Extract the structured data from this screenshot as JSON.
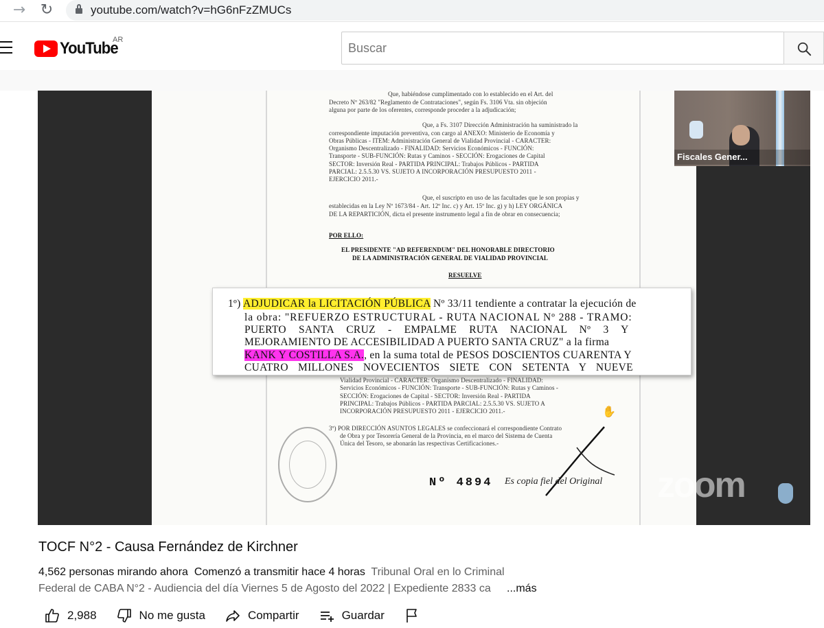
{
  "browser": {
    "url": "youtube.com/watch?v=hG6nFzZMUCs",
    "forward_icon": "arrow-forward-icon",
    "reload_icon": "reload-icon"
  },
  "header": {
    "logo_text": "YouTube",
    "region": "AR",
    "search_placeholder": "Buscar"
  },
  "video": {
    "camera_label": "Fiscales Gener...",
    "watermark": "zoom",
    "doc_top_lines": [
      "Que, habiéndose cumplimentado con lo establecido en el Art. del",
      "Decreto Nº 263/82 \"Reglamento de Contrataciones\", según Fs. 3106 Vta. sin objeción",
      "alguna por parte de los oferentes, corresponde proceder a la adjudicación;",
      "Que, a Fs. 3107 Dirección Administración ha suministrado la",
      "correspondiente imputación preventiva, con cargo al ANEXO: Ministerio de Economía y",
      "Obras Públicas - ITEM: Administración General de Vialidad Provincial - CARACTER:",
      "Organismo Descentralizado - FINALIDAD: Servicios Económicos - FUNCIÓN:",
      "Transporte - SUB-FUNCIÓN: Rutas y Caminos - SECCIÓN: Erogaciones de Capital",
      "SECTOR: Inversión Real - PARTIDA PRINCIPAL: Trabajos Públicos - PARTIDA",
      "PARCIAL: 2.5.5.30 VS. SUJETO A INCORPORACIÓN PRESUPUESTO 2011 -",
      "EJERCICIO 2011.-",
      "Que, el suscripto en uso de las facultades que le son propias y",
      "establecidas en la Ley Nº 1673/84 - Art. 12º Inc. c) y Art. 15º Inc. g) y h) LEY ORGÁNICA",
      "DE LA REPARTICIÓN, dicta el presente instrumento legal a fin de obrar en consecuencia;"
    ],
    "por_ello": "POR ELLO:",
    "president_lines": [
      "EL PRESIDENTE \"AD REFERENDUM\" DEL HONORABLE DIRECTORIO",
      "DE LA ADMINISTRACIÓN GENERAL DE VIALIDAD PROVINCIAL"
    ],
    "resuelve": "RESUELVE",
    "highlight": {
      "num": "1º)",
      "yellow_text": "ADJUDICAR la LICITACIÓN PÚBLICA",
      "line1_rest": " Nº 33/11 tendiente a contratar la ejecución de",
      "line2": "la obra: \"REFUERZO ESTRUCTURAL - RUTA NACIONAL Nº 288 - TRAMO:",
      "line3": "PUERTO SANTA CRUZ - EMPALME RUTA NACIONAL Nº 3 Y",
      "line4": "MEJORAMIENTO DE ACCESIBILIDAD A PUERTO SANTA CRUZ\" a la firma",
      "pink_text": "KANK Y COSTILLA S.A.",
      "line5_rest": ", en la suma total de PESOS DOSCIENTOS CUARENTA Y",
      "line6": "CUATRO MILLONES NOVECIENTOS SIETE CON SETENTA Y NUEVE"
    },
    "doc_bottom_lines": [
      "Vialidad Provincial - CARACTER: Organismo Descentralizado - FINALIDAD:",
      "Servicios Económicos - FUNCIÓN: Transporte - SUB-FUNCIÓN: Rutas y Caminos -",
      "SECCIÓN: Erogaciones de Capital - SECTOR: Inversión Real - PARTIDA",
      "PRINCIPAL: Trabajos Públicos - PARTIDA PARCIAL: 2.5.5.30 VS. SUJETO A",
      "INCORPORACIÓN PRESUPUESTO 2011 - EJERCICIO 2011.-",
      "3º) POR DIRECCIÓN ASUNTOS LEGALES se confeccionará el correspondiente Contrato",
      "de Obra y por Tesorería General de la Provincia, en el marco del Sistema de Cuenta",
      "Única del Tesoro, se abonarán las respectivas Certificaciones.-"
    ],
    "doc_number": "4894",
    "doc_prefix": "Nº",
    "original_text": "Es copia fiel del Original"
  },
  "info": {
    "title": "TOCF N°2 - Causa Fernández de Kirchner",
    "viewers": "4,562 personas mirando ahora",
    "started": "Comenzó a transmitir hace 4 horas",
    "desc_line1": "Tribunal Oral en lo Criminal",
    "desc_line2": "Federal de CABA N°2 - Audiencia del día Viernes 5 de Agosto del 2022 | Expediente 2833 ca",
    "more": "...más"
  },
  "actions": {
    "likes": "2,988",
    "dislike": "No me gusta",
    "share": "Compartir",
    "save": "Guardar"
  }
}
